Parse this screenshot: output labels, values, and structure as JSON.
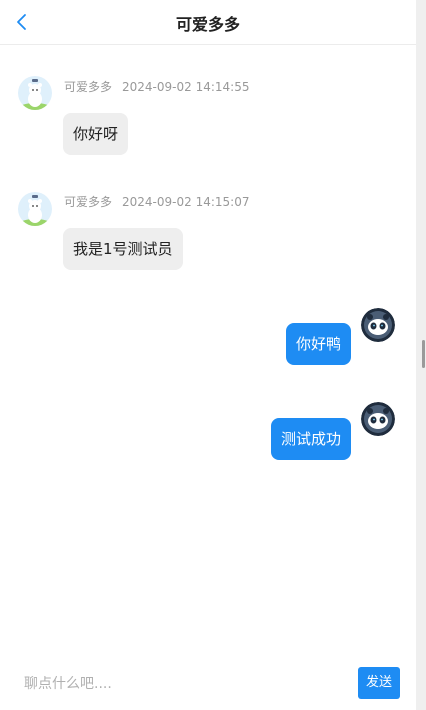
{
  "header": {
    "title": "可爱多多",
    "back_icon": "chevron-left-icon"
  },
  "messages": [
    {
      "sender": "可爱多多",
      "time": "2024-09-02 14:14:55",
      "text": "你好呀",
      "direction": "in"
    },
    {
      "sender": "可爱多多",
      "time": "2024-09-02 14:15:07",
      "text": "我是1号测试员",
      "direction": "in"
    },
    {
      "text": "你好鸭",
      "direction": "out"
    },
    {
      "text": "测试成功",
      "direction": "out"
    }
  ],
  "composer": {
    "placeholder": "聊点什么吧....",
    "send_label": "发送"
  },
  "colors": {
    "accent": "#1e8cf3",
    "incoming_bubble": "#eeeeee",
    "meta_text": "#999999"
  }
}
